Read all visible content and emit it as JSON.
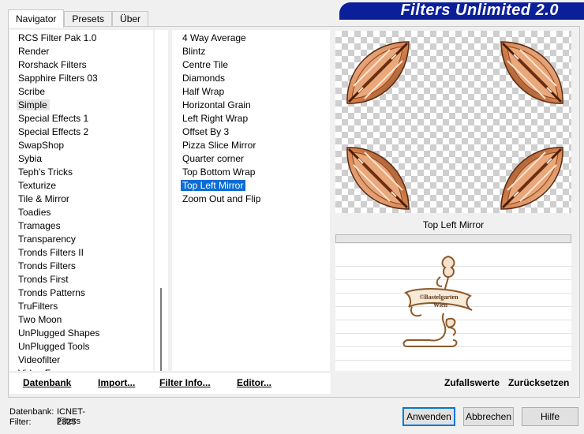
{
  "tabs": [
    "Navigator",
    "Presets",
    "Über"
  ],
  "banner_title": "Filters Unlimited 2.0",
  "categories": [
    "RCS Filter Pak 1.0",
    "Render",
    "Rorshack Filters",
    "Sapphire Filters 03",
    "Scribe",
    "Simple",
    "Special Effects 1",
    "Special Effects 2",
    "SwapShop",
    "Sybia",
    "Teph's Tricks",
    "Texturize",
    "Tile & Mirror",
    "Toadies",
    "Tramages",
    "Transparency",
    "Tronds Filters II",
    "Tronds Filters",
    "Tronds First",
    "Tronds Patterns",
    "TruFilters",
    "Two Moon",
    "UnPlugged Shapes",
    "UnPlugged Tools",
    "Videofilter",
    "Video Fu..."
  ],
  "selected_category": "Simple",
  "filters": [
    "4 Way Average",
    "Blintz",
    "Centre Tile",
    "Diamonds",
    "Half Wrap",
    "Horizontal Grain",
    "Left Right Wrap",
    "Offset By 3",
    "Pizza Slice Mirror",
    "Quarter corner",
    "Top Bottom Wrap",
    "Top Left Mirror",
    "Zoom Out and Flip"
  ],
  "selected_filter": "Top Left Mirror",
  "preview_filter_name": "Top Left Mirror",
  "logo_text": [
    "©Bastelgarten",
    "Wien"
  ],
  "toolbar": {
    "datenbank": "Datenbank",
    "import": "Import...",
    "filter_info": "Filter Info...",
    "editor": "Editor...",
    "zufallswerte": "Zufallswerte",
    "zuruecksetzen": "Zurücksetzen"
  },
  "status": {
    "datenbank_label": "Datenbank:",
    "datenbank_value": "ICNET-Filters",
    "filter_label": "Filter:",
    "filter_value": "2325"
  },
  "buttons": {
    "apply": "Anwenden",
    "cancel": "Abbrechen",
    "help": "Hilfe"
  },
  "colors": {
    "banner": "#0b1f9a",
    "selection": "#0a6cd6",
    "accent": "#0078d7",
    "leaf_brown": "#b5643c"
  }
}
